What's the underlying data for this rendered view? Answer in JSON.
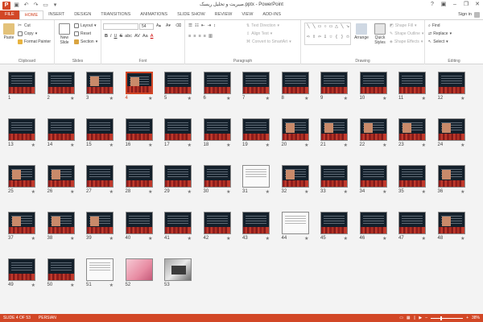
{
  "window": {
    "title": "صیریت و تحلیل ریسک.pptx - PowerPoint",
    "app_logo": "P"
  },
  "ribbon_tabs": [
    "FILE",
    "HOME",
    "INSERT",
    "DESIGN",
    "TRANSITIONS",
    "ANIMATIONS",
    "SLIDE SHOW",
    "REVIEW",
    "VIEW",
    "ADD-INS"
  ],
  "account": {
    "signin": "Sign in"
  },
  "clipboard": {
    "paste": "Paste",
    "cut": "Cut",
    "copy": "Copy",
    "format_painter": "Format Painter",
    "label": "Clipboard"
  },
  "slides_group": {
    "new_slide": "New Slide",
    "layout": "Layout",
    "reset": "Reset",
    "section": "Section",
    "label": "Slides"
  },
  "font_group": {
    "font_size": "54",
    "label": "Font",
    "bold": "B",
    "italic": "I",
    "underline": "U",
    "strike": "S",
    "shadow": "abc",
    "spacing": "AV",
    "case": "Aa",
    "color": "A"
  },
  "paragraph": {
    "text_direction": "Text Direction",
    "align_text": "Align Text",
    "smartart": "Convert to SmartArt",
    "label": "Paragraph"
  },
  "drawing": {
    "arrange": "Arrange",
    "quick_styles": "Quick Styles",
    "shape_fill": "Shape Fill",
    "shape_outline": "Shape Outline",
    "shape_effects": "Shape Effects",
    "label": "Drawing"
  },
  "editing": {
    "find": "Find",
    "replace": "Replace",
    "select": "Select",
    "label": "Editing"
  },
  "slides": [
    {
      "n": "1",
      "star": false,
      "kind": "title"
    },
    {
      "n": "2",
      "star": true,
      "kind": "text"
    },
    {
      "n": "3",
      "star": true,
      "kind": "pic"
    },
    {
      "n": "4",
      "star": true,
      "kind": "pic",
      "selected": true
    },
    {
      "n": "5",
      "star": true,
      "kind": "text"
    },
    {
      "n": "6",
      "star": true,
      "kind": "text"
    },
    {
      "n": "7",
      "star": true,
      "kind": "text"
    },
    {
      "n": "8",
      "star": true,
      "kind": "text"
    },
    {
      "n": "9",
      "star": true,
      "kind": "text"
    },
    {
      "n": "10",
      "star": true,
      "kind": "text"
    },
    {
      "n": "11",
      "star": true,
      "kind": "text"
    },
    {
      "n": "12",
      "star": true,
      "kind": "text"
    },
    {
      "n": "13",
      "star": true,
      "kind": "text"
    },
    {
      "n": "14",
      "star": true,
      "kind": "text"
    },
    {
      "n": "15",
      "star": true,
      "kind": "text"
    },
    {
      "n": "16",
      "star": true,
      "kind": "text"
    },
    {
      "n": "17",
      "star": true,
      "kind": "text"
    },
    {
      "n": "18",
      "star": true,
      "kind": "text"
    },
    {
      "n": "19",
      "star": true,
      "kind": "text"
    },
    {
      "n": "20",
      "star": true,
      "kind": "pic"
    },
    {
      "n": "21",
      "star": true,
      "kind": "pic"
    },
    {
      "n": "22",
      "star": true,
      "kind": "pic"
    },
    {
      "n": "23",
      "star": true,
      "kind": "pic"
    },
    {
      "n": "24",
      "star": true,
      "kind": "pic"
    },
    {
      "n": "25",
      "star": true,
      "kind": "pic"
    },
    {
      "n": "26",
      "star": true,
      "kind": "pic"
    },
    {
      "n": "27",
      "star": true,
      "kind": "text"
    },
    {
      "n": "28",
      "star": true,
      "kind": "text"
    },
    {
      "n": "29",
      "star": true,
      "kind": "text"
    },
    {
      "n": "30",
      "star": true,
      "kind": "text"
    },
    {
      "n": "31",
      "star": true,
      "kind": "light"
    },
    {
      "n": "32",
      "star": true,
      "kind": "pic"
    },
    {
      "n": "33",
      "star": true,
      "kind": "text"
    },
    {
      "n": "34",
      "star": true,
      "kind": "text"
    },
    {
      "n": "35",
      "star": true,
      "kind": "text"
    },
    {
      "n": "36",
      "star": true,
      "kind": "pic"
    },
    {
      "n": "37",
      "star": true,
      "kind": "pic"
    },
    {
      "n": "38",
      "star": true,
      "kind": "pic"
    },
    {
      "n": "39",
      "star": true,
      "kind": "pic"
    },
    {
      "n": "40",
      "star": true,
      "kind": "text"
    },
    {
      "n": "41",
      "star": true,
      "kind": "text"
    },
    {
      "n": "42",
      "star": true,
      "kind": "text"
    },
    {
      "n": "43",
      "star": true,
      "kind": "text"
    },
    {
      "n": "44",
      "star": true,
      "kind": "light"
    },
    {
      "n": "45",
      "star": true,
      "kind": "text"
    },
    {
      "n": "46",
      "star": true,
      "kind": "text"
    },
    {
      "n": "47",
      "star": true,
      "kind": "text"
    },
    {
      "n": "48",
      "star": true,
      "kind": "pic"
    },
    {
      "n": "49",
      "star": true,
      "kind": "text"
    },
    {
      "n": "50",
      "star": true,
      "kind": "text"
    },
    {
      "n": "51",
      "star": true,
      "kind": "light"
    },
    {
      "n": "52",
      "star": false,
      "kind": "photo1"
    },
    {
      "n": "53",
      "star": false,
      "kind": "photo2"
    }
  ],
  "star_glyph": "★",
  "status": {
    "slide_of": "SLIDE 4 OF 53",
    "language": "PERSIAN",
    "zoom": "38%"
  }
}
